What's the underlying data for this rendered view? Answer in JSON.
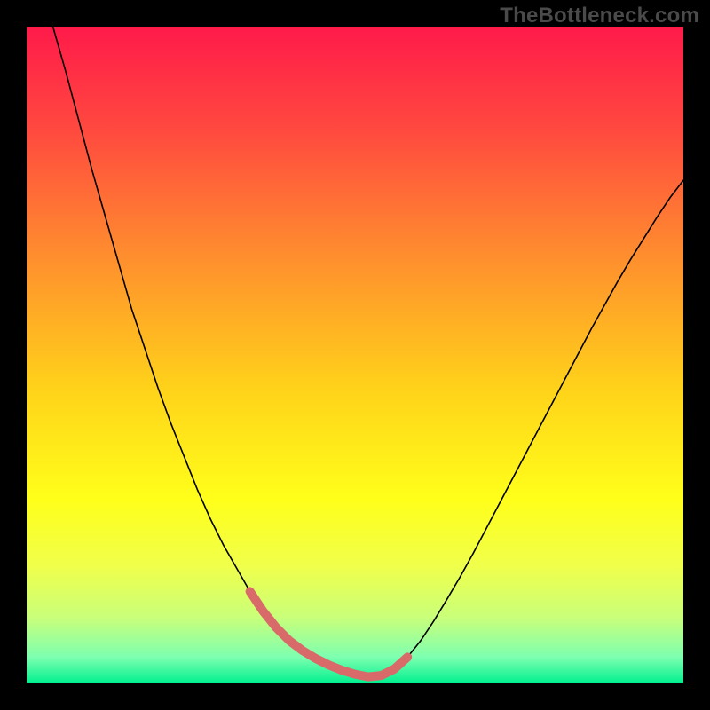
{
  "watermark": "TheBottleneck.com",
  "chart_data": {
    "type": "line",
    "title": "",
    "xlabel": "",
    "ylabel": "",
    "xlim": [
      0,
      100
    ],
    "ylim": [
      0,
      100
    ],
    "gradient_stops": [
      {
        "offset": 0.0,
        "color": "#ff1a4a"
      },
      {
        "offset": 0.16,
        "color": "#ff4a3f"
      },
      {
        "offset": 0.35,
        "color": "#ff8e2e"
      },
      {
        "offset": 0.55,
        "color": "#ffd21a"
      },
      {
        "offset": 0.72,
        "color": "#ffff1a"
      },
      {
        "offset": 0.82,
        "color": "#f0ff4a"
      },
      {
        "offset": 0.9,
        "color": "#c9ff7a"
      },
      {
        "offset": 0.96,
        "color": "#7dffb0"
      },
      {
        "offset": 1.0,
        "color": "#00f08f"
      }
    ],
    "series": [
      {
        "name": "curve",
        "stroke": "#000000",
        "stroke_width": 1.6,
        "x": [
          4,
          6,
          8,
          10,
          12,
          14,
          16,
          18,
          20,
          22,
          24,
          26,
          28,
          30,
          32,
          34,
          36,
          38,
          40,
          42,
          44,
          46,
          48,
          50,
          52,
          54,
          56,
          58,
          60,
          62,
          64,
          66,
          68,
          70,
          72,
          74,
          76,
          78,
          80,
          82,
          84,
          86,
          88,
          90,
          92,
          94,
          96,
          98,
          100
        ],
        "y": [
          100,
          93,
          85.5,
          78,
          71,
          64,
          57,
          51,
          45,
          39.5,
          34.5,
          29.5,
          25,
          21,
          17.5,
          14,
          11,
          8.5,
          6.5,
          5,
          3.8,
          2.8,
          2,
          1.4,
          1,
          1.2,
          2.2,
          4,
          6.5,
          9.5,
          12.8,
          16.2,
          19.8,
          23.6,
          27.4,
          31.2,
          35,
          38.8,
          42.6,
          46.4,
          50.2,
          54,
          57.6,
          61.2,
          64.6,
          67.8,
          71,
          74,
          76.6
        ]
      },
      {
        "name": "sweet-spot-overlay",
        "stroke": "#d96a6a",
        "stroke_width": 10,
        "x": [
          34,
          36,
          38,
          40,
          42,
          44,
          46,
          48,
          50,
          52,
          54,
          56,
          58
        ],
        "y": [
          14,
          11,
          8.5,
          6.5,
          5,
          3.8,
          2.8,
          2,
          1.4,
          1,
          1.2,
          2.2,
          4
        ]
      }
    ]
  }
}
